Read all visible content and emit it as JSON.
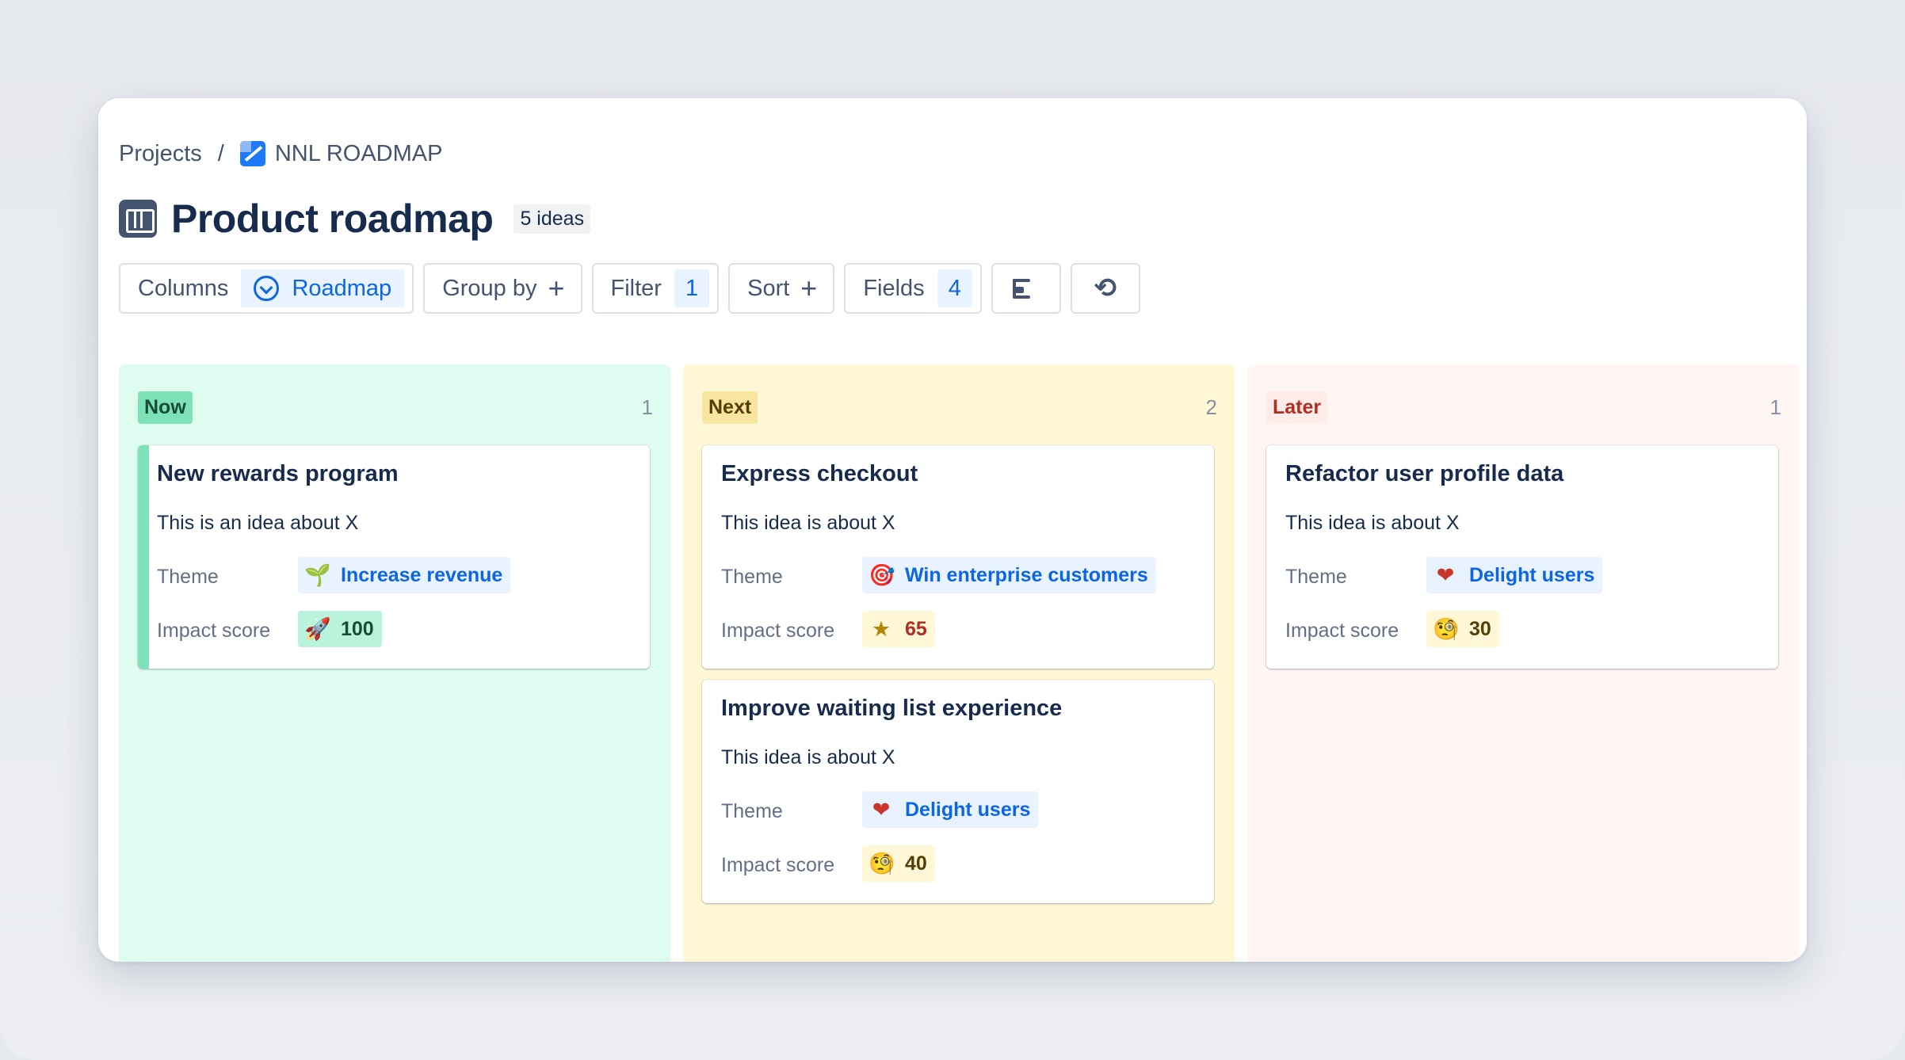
{
  "breadcrumb": {
    "root": "Projects",
    "separator": "/",
    "project": "NNL ROADMAP",
    "project_icon": "project-logo-icon"
  },
  "header": {
    "title": "Product roadmap",
    "count": "5 ideas",
    "icon": "board-columns-icon"
  },
  "toolbar": {
    "columns_label": "Columns",
    "columns_value": "Roadmap",
    "groupby_label": "Group by",
    "groupby_icon": "plus-icon",
    "filter_label": "Filter",
    "filter_count": "1",
    "sort_label": "Sort",
    "sort_icon": "plus-icon",
    "fields_label": "Fields",
    "fields_count": "4",
    "row_height_icon": "row-height-icon",
    "autofit_icon": "text-wrap-icon"
  },
  "columns": [
    {
      "label": "Now",
      "count": "1",
      "color": "#dffcf0",
      "cards": [
        {
          "title": "New rewards program",
          "desc": "This is an idea about X",
          "theme_label": "Theme",
          "theme": "Increase revenue",
          "theme_emoji": "🌱",
          "score_label": "Impact score",
          "score": "100",
          "score_emoji": "🚀"
        }
      ]
    },
    {
      "label": "Next",
      "count": "2",
      "color": "#fff7d6",
      "cards": [
        {
          "title": "Express checkout",
          "desc": "This idea is about X",
          "theme_label": "Theme",
          "theme": "Win enterprise customers",
          "theme_emoji": "🎯",
          "score_label": "Impact score",
          "score": "65",
          "score_emoji": "★"
        },
        {
          "title": "Improve waiting list experience",
          "desc": "This idea is about X",
          "theme_label": "Theme",
          "theme": "Delight users",
          "theme_emoji": "❤",
          "score_label": "Impact score",
          "score": "40",
          "score_emoji": "🧐"
        }
      ]
    },
    {
      "label": "Later",
      "count": "1",
      "color": "#fff5f3",
      "cards": [
        {
          "title": "Refactor user profile data",
          "desc": "This idea is about X",
          "theme_label": "Theme",
          "theme": "Delight users",
          "theme_emoji": "❤",
          "score_label": "Impact score",
          "score": "30",
          "score_emoji": "🧐"
        }
      ]
    }
  ]
}
